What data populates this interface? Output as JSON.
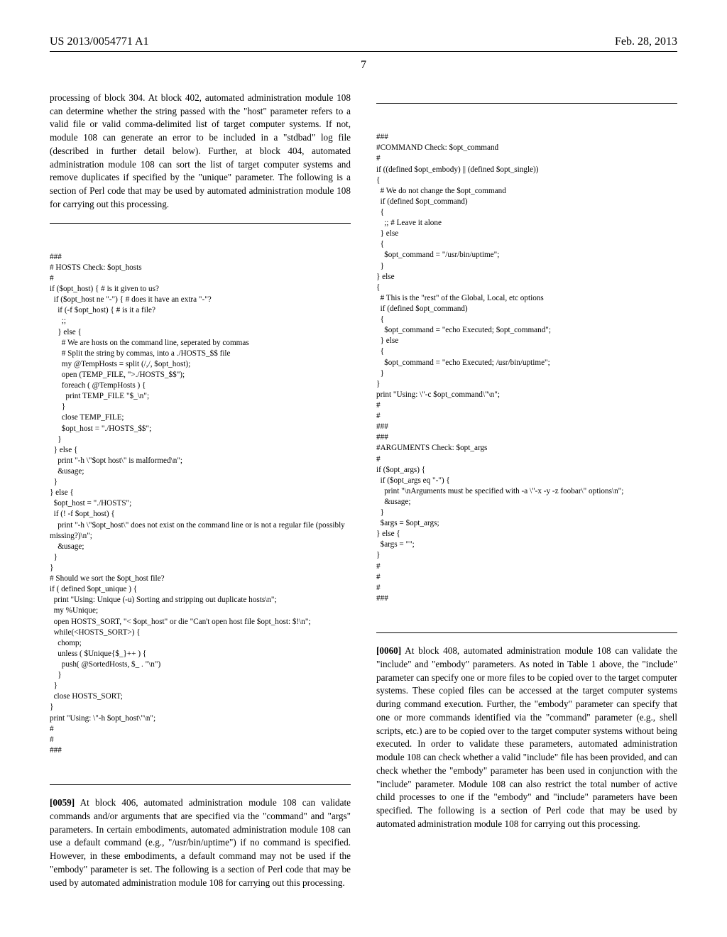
{
  "header": {
    "left": "US 2013/0054771 A1",
    "right": "Feb. 28, 2013"
  },
  "page_number": "7",
  "left_col": {
    "para1": "processing of block 304. At block 402, automated administration module 108 can determine whether the string passed with the \"host\" parameter refers to a valid file or valid comma-delimited list of target computer systems. If not, module 108 can generate an error to be included in a \"stdbad\" log file (described in further detail below). Further, at block 404, automated administration module 108 can sort the list of target computer systems and remove duplicates if specified by the \"unique\" parameter. The following is a section of Perl code that may be used by automated administration module 108 for carrying out this processing.",
    "code1": "###\n# HOSTS Check: $opt_hosts\n#\nif ($opt_host) { # is it given to us?\n  if ($opt_host ne \"-\") { # does it have an extra \"-\"?\n    if (-f $opt_host) { # is it a file?\n      ;;\n    } else {\n      # We are hosts on the command line, seperated by commas\n      # Split the string by commas, into a ./HOSTS_$$ file\n      my @TempHosts = split (/,/, $opt_host);\n      open (TEMP_FILE, \">./HOSTS_$$\");\n      foreach ( @TempHosts ) {\n        print TEMP_FILE \"$_\\n\";\n      }\n      close TEMP_FILE;\n      $opt_host = \"./HOSTS_$$\";\n    }\n  } else {\n    print \"-h \\\"$opt host\\\" is malformed\\n\";\n    &usage;\n  }\n} else {\n  $opt_host = \"./HOSTS\";\n  if (! -f $opt_host) {\n    print \"-h \\\"$opt_host\\\" does not exist on the command line or is not a regular file (possibly missing?)\\n\";\n    &usage;\n  }\n}\n# Should we sort the $opt_host file?\nif ( defined $opt_unique ) {\n  print \"Using: Unique (-u) Sorting and stripping out duplicate hosts\\n\";\n  my %Unique;\n  open HOSTS_SORT, \"< $opt_host\" or die \"Can't open host file $opt_host: $!\\n\";\n  while(<HOSTS_SORT>) {\n    chomp;\n    unless ( $Unique{$_}++ ) {\n      push( @SortedHosts, $_ . \"\\n\")\n    }\n  }\n  close HOSTS_SORT;\n}\nprint \"Using: \\\"-h $opt_host\\\"\\n\";\n#\n#\n###",
    "para2_label": "[0059]",
    "para2": "   At block 406, automated administration module 108 can validate commands and/or arguments that are specified via the \"command\" and \"args\" parameters. In certain embodiments, automated administration module 108 can use a default command (e.g., \"/usr/bin/uptime\") if no command is specified. However, in these embodiments, a default command may not be used if the \"embody\" parameter is set. The following is a section of Perl code that may be used by automated administration module 108 for carrying out this processing."
  },
  "right_col": {
    "code1": "###\n#COMMAND Check: $opt_command\n#\nif ((defined $opt_embody) || (defined $opt_single))\n{\n  # We do not change the $opt_command\n  if (defined $opt_command)\n  {\n    ;; # Leave it alone\n  } else\n  {\n    $opt_command = \"/usr/bin/uptime\";\n  }\n} else\n{\n  # This is the \"rest\" of the Global, Local, etc options\n  if (defined $opt_command)\n  {\n    $opt_command = \"echo Executed; $opt_command\";\n  } else\n  {\n    $opt_command = \"echo Executed; /usr/bin/uptime\";\n  }\n}\nprint \"Using: \\\"-c $opt_command\\\"\\n\";\n#\n#\n###\n###\n#ARGUMENTS Check: $opt_args\n#\nif ($opt_args) {\n  if ($opt_args eq \"-\") {\n    print \"\\nArguments must be specified with -a \\\"-x -y -z foobar\\\" options\\n\";\n    &usage;\n  }\n  $args = $opt_args;\n} else {\n  $args = \"\";\n}\n#\n#\n#\n###",
    "para1_label": "[0060]",
    "para1": "   At block 408, automated administration module 108 can validate the \"include\" and \"embody\" parameters. As noted in Table 1 above, the \"include\" parameter can specify one or more files to be copied over to the target computer systems. These copied files can be accessed at the target computer systems during command execution. Further, the \"embody\" parameter can specify that one or more commands identified via the \"command\" parameter (e.g., shell scripts, etc.) are to be copied over to the target computer systems without being executed. In order to validate these parameters, automated administration module 108 can check whether a valid \"include\" file has been provided, and can check whether the \"embody\" parameter has been used in conjunction with the \"include\" parameter. Module 108 can also restrict the total number of active child processes to one if the \"embody\" and \"include\" parameters have been specified. The following is a section of Perl code that may be used by automated administration module 108 for carrying out this processing."
  }
}
